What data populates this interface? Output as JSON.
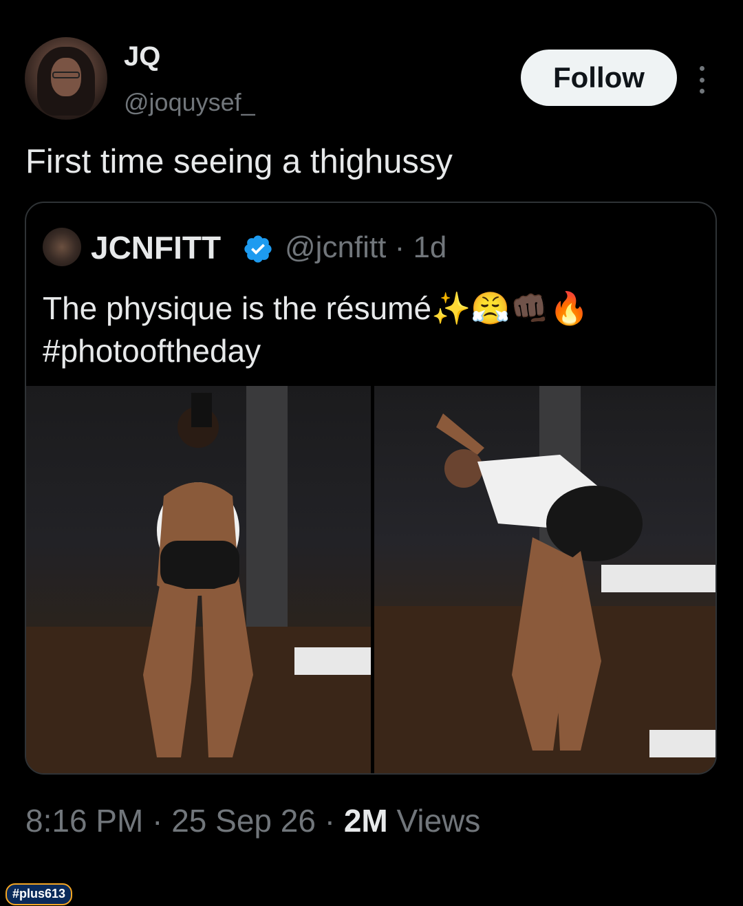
{
  "author": {
    "display_name": "JQ",
    "handle": "@joquysef_"
  },
  "follow_label": "Follow",
  "tweet_text": "First time seeing a thighussy",
  "quoted": {
    "display_name": "JCNFITT",
    "handle_time": "@jcnfitt · 1d",
    "text": "The physique is the résumé✨😤👊🏿🔥 #photooftheday",
    "verified_color": "#1d9bf0"
  },
  "meta": {
    "time_date": "8:16 PM · 25 Sep 26 · ",
    "views_count": "2M",
    "views_label": " Views"
  },
  "watermark": "#plus613"
}
